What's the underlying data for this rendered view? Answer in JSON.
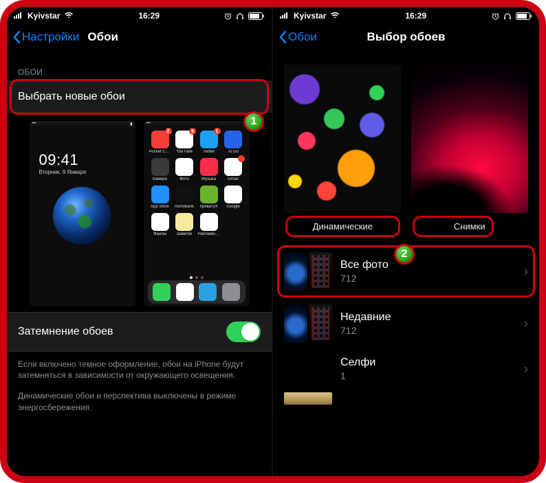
{
  "statusbar": {
    "carrier": "Kyivstar",
    "time": "16:29"
  },
  "left": {
    "back": "Настройки",
    "title": "Обои",
    "section": "ОБОИ",
    "choose_new": "Выбрать новые обои",
    "lock_time": "09:41",
    "lock_date": "Вторник, 9 Января",
    "apps": [
      {
        "l": "Pocket Casts",
        "c": "#f43e37",
        "b": "2"
      },
      {
        "l": "YouTube",
        "c": "#ffffff",
        "b": "9"
      },
      {
        "l": "Twitter",
        "c": "#1da1f2",
        "b": "1"
      },
      {
        "l": "To Do",
        "c": "#2563eb"
      },
      {
        "l": "Камера",
        "c": "#3a3a3c"
      },
      {
        "l": "Фото",
        "c": "#ffffff"
      },
      {
        "l": "Музыка",
        "c": "#fa2d48"
      },
      {
        "l": "Gmail",
        "c": "#ffffff",
        "b": ""
      },
      {
        "l": "App Store",
        "c": "#1e90ff"
      },
      {
        "l": "monobank",
        "c": "#111111"
      },
      {
        "l": "приват24",
        "c": "#6ab42d"
      },
      {
        "l": "Google",
        "c": "#ffffff"
      },
      {
        "l": "Файлы",
        "c": "#ffffff"
      },
      {
        "l": "Заметки",
        "c": "#f7e9a0"
      },
      {
        "l": "Напоминания",
        "c": "#ffffff"
      }
    ],
    "dock": [
      {
        "n": "phone",
        "c": "#30d158"
      },
      {
        "n": "safari",
        "c": "#ffffff"
      },
      {
        "n": "telegram",
        "c": "#2aa1de"
      },
      {
        "n": "settings",
        "c": "#8e8e93"
      }
    ],
    "dim_label": "Затемнение обоев",
    "hint1": "Если включено темное оформление, обои на iPhone будут затемняться в зависимости от окружающего освещения.",
    "hint2": "Динамические обои и перспектива выключены в режиме энергосбережения."
  },
  "right": {
    "back": "Обои",
    "title": "Выбор обоев",
    "cat_dynamic": "Динамические",
    "cat_stills": "Снимки",
    "albums": [
      {
        "title": "Все фото",
        "count": "712"
      },
      {
        "title": "Недавние",
        "count": "712"
      },
      {
        "title": "Селфи",
        "count": "1"
      }
    ]
  },
  "markers": {
    "one": "1",
    "two": "2"
  }
}
